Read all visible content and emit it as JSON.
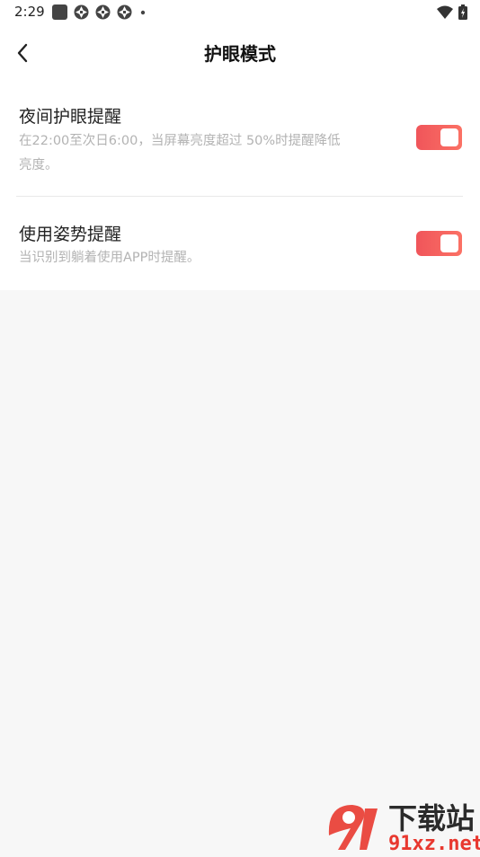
{
  "status_bar": {
    "time": "2:29"
  },
  "app_bar": {
    "title": "护眼模式",
    "back_icon": "chevron-left-icon"
  },
  "settings": [
    {
      "title": "夜间护眼提醒",
      "desc_line1": "在22:00至次日6:00，当屏幕亮度超过 50%时提醒降低",
      "desc_line2": "亮度。",
      "enabled": true
    },
    {
      "title": "使用姿势提醒",
      "desc_line1": "当识别到躺着使用APP时提醒。",
      "enabled": true
    }
  ],
  "colors": {
    "toggle_on": "#f0555a",
    "watermark_red": "#e8382f",
    "watermark_dark": "#2b2b2b"
  },
  "watermark": {
    "text_big": "下载站",
    "text_url": "91xz.net"
  }
}
